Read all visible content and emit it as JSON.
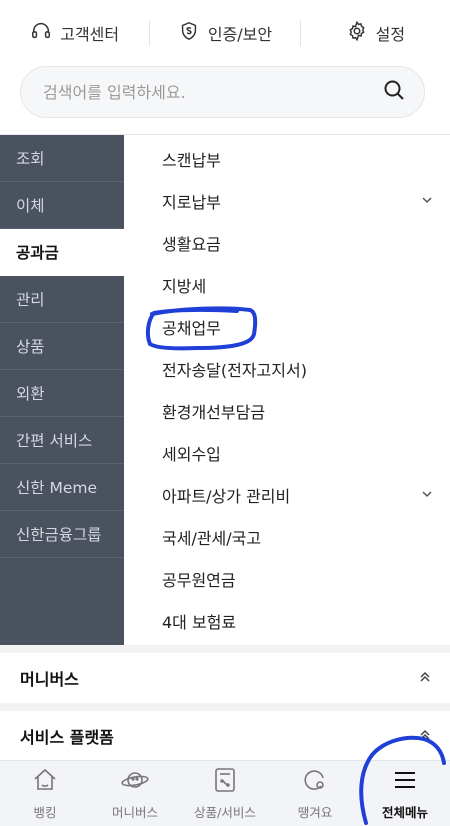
{
  "top_links": [
    {
      "label": "고객센터",
      "icon": "headset-icon"
    },
    {
      "label": "인증/보안",
      "icon": "shield-icon"
    },
    {
      "label": "설정",
      "icon": "gear-icon"
    }
  ],
  "search": {
    "placeholder": "검색어를 입력하세요.",
    "icon": "search-icon"
  },
  "categories": [
    "조회",
    "이체",
    "공과금",
    "관리",
    "상품",
    "외환",
    "간편 서비스",
    "신한 Meme",
    "신한금융그룹"
  ],
  "active_category": "공과금",
  "submenu": [
    {
      "label": "스캔납부",
      "expandable": false
    },
    {
      "label": "지로납부",
      "expandable": true
    },
    {
      "label": "생활요금",
      "expandable": false
    },
    {
      "label": "지방세",
      "expandable": false
    },
    {
      "label": "공채업무",
      "expandable": false
    },
    {
      "label": "전자송달(전자고지서)",
      "expandable": false
    },
    {
      "label": "환경개선부담금",
      "expandable": false
    },
    {
      "label": "세외수입",
      "expandable": false
    },
    {
      "label": "아파트/상가 관리비",
      "expandable": true
    },
    {
      "label": "국세/관세/국고",
      "expandable": false
    },
    {
      "label": "공무원연금",
      "expandable": false
    },
    {
      "label": "4대 보험료",
      "expandable": false
    }
  ],
  "sections": [
    {
      "label": "머니버스",
      "icon": "double-chevron-up-icon"
    },
    {
      "label": "서비스 플랫폼",
      "icon": "double-chevron-up-icon"
    }
  ],
  "bottom_nav": [
    {
      "label": "뱅킹",
      "icon": "home-icon"
    },
    {
      "label": "머니버스",
      "icon": "planet-icon"
    },
    {
      "label": "상품/서비스",
      "icon": "calculator-icon"
    },
    {
      "label": "땡겨요",
      "icon": "delivery-icon"
    },
    {
      "label": "전체메뉴",
      "icon": "hamburger-icon"
    }
  ],
  "active_nav": "전체메뉴",
  "colors": {
    "category_bg": "#4a5260",
    "highlight_scribble": "#1f3fd6",
    "nav_bg": "#f3f4f7"
  }
}
